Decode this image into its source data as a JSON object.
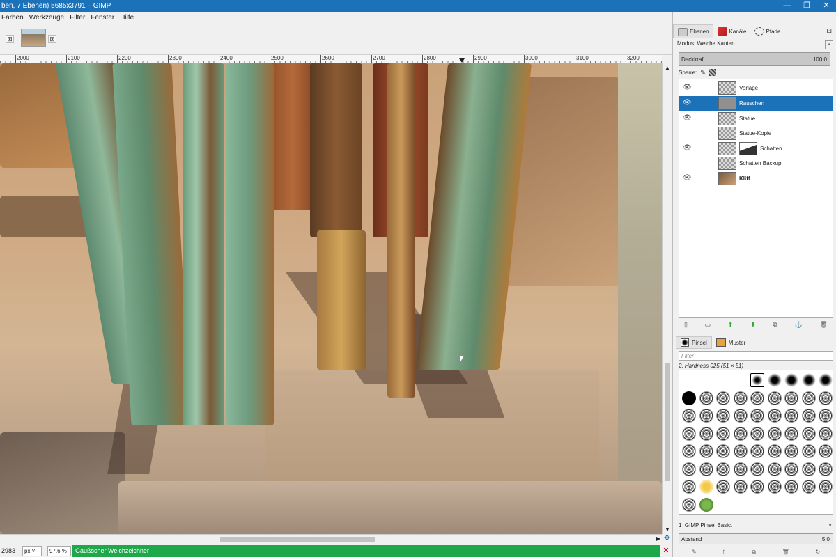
{
  "window": {
    "title": "ben, 7 Ebenen) 5685x3791 – GIMP",
    "min": "—",
    "max": "❐",
    "close": "✕"
  },
  "menu": [
    "Farben",
    "Werkzeuge",
    "Filter",
    "Fenster",
    "Hilfe"
  ],
  "image_tabs": {
    "close1": "⊠",
    "close2": "⊠"
  },
  "ruler": {
    "labels": [
      "2000",
      "2100",
      "2200",
      "2300",
      "2400",
      "2500",
      "2600",
      "2700",
      "2800",
      "2900",
      "3000",
      "3100",
      "3200"
    ]
  },
  "statusbar": {
    "coord": "2983",
    "unit": "px",
    "zoom": "97.6 %",
    "message": "Gaußscher Weichzeichner",
    "close": "✕"
  },
  "layers_dock": {
    "tabs": [
      {
        "label": "Ebenen"
      },
      {
        "label": "Kanäle"
      },
      {
        "label": "Pfade"
      }
    ],
    "mode": "Modus: Weiche Kanten",
    "opacity_label": "Deckkraft",
    "opacity_value": "100.0",
    "lock_label": "Sperre:",
    "layers": [
      {
        "name": "Vorlage",
        "visible": true,
        "selected": false
      },
      {
        "name": "Rauschen",
        "visible": true,
        "selected": true
      },
      {
        "name": "Statue",
        "visible": true,
        "selected": false
      },
      {
        "name": "Statue-Kopie",
        "visible": false,
        "selected": false
      },
      {
        "name": "Schatten",
        "visible": true,
        "selected": false
      },
      {
        "name": "Schatten Backup",
        "visible": false,
        "selected": false
      },
      {
        "name": "Kliff",
        "visible": true,
        "selected": false
      }
    ],
    "eye": "👁"
  },
  "brushes_dock": {
    "tabs": [
      {
        "label": "Pinsel"
      },
      {
        "label": "Muster"
      }
    ],
    "filter_placeholder": "Filter",
    "selected_brush": "2. Hardness 025 (51 × 51)",
    "brush_set": "1_GIMP Pinsel Basic.",
    "spacing_label": "Abstand",
    "spacing_value": "5.0"
  },
  "colors": {
    "titlebar": "#1c72b8",
    "selection": "#1c72b8",
    "status": "#1ea84a"
  }
}
